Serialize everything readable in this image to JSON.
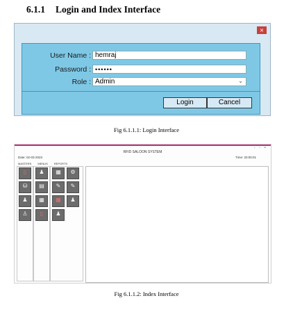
{
  "section": {
    "number": "6.1.1",
    "title": "Login and Index Interface"
  },
  "login": {
    "close_glyph": "×",
    "user_label": "User Name :",
    "user_value": "hemraj",
    "password_label": "Password :",
    "password_value": "••••••",
    "role_label": "Role :",
    "role_value": "Admin",
    "login_button": "Login",
    "cancel_button": "Cancel"
  },
  "caption1": "Fig 6.1.1.1: Login Interface",
  "index": {
    "window_controls": "- ▫ ×",
    "system_title": "RFID SALOON SYSTEM",
    "date": "Date:  02-03-2023",
    "time": "Time:  20:00:01",
    "menus": [
      "MASTERS",
      "MENUS",
      "REPORTS"
    ],
    "tiles": {
      "masters": [
        {
          "icon": "door-icon",
          "glyph": "▯",
          "label": ""
        },
        {
          "icon": "database-icon",
          "glyph": "⛁",
          "label": ""
        },
        {
          "icon": "people-icon",
          "glyph": "♟",
          "label": ""
        },
        {
          "icon": "person-icon",
          "glyph": "♙",
          "label": ""
        }
      ],
      "menus": [
        {
          "icon": "user-icon",
          "glyph": "♟",
          "label": ""
        },
        {
          "icon": "printer-icon",
          "glyph": "▤",
          "label": ""
        },
        {
          "icon": "chart-icon",
          "glyph": "▦",
          "label": ""
        },
        {
          "icon": "door-icon",
          "glyph": "▯",
          "label": ""
        }
      ],
      "reports_left": [
        {
          "icon": "register-icon",
          "glyph": "▦",
          "label": ""
        },
        {
          "icon": "pen-icon",
          "glyph": "✎",
          "label": ""
        },
        {
          "icon": "report-icon",
          "glyph": "▦",
          "label": ""
        },
        {
          "icon": "people-icon",
          "glyph": "♟",
          "label": ""
        }
      ],
      "reports_right": [
        {
          "icon": "network-icon",
          "glyph": "⚙",
          "label": ""
        },
        {
          "icon": "edit-icon",
          "glyph": "✎",
          "label": ""
        },
        {
          "icon": "people-icon",
          "glyph": "♟",
          "label": ""
        }
      ]
    }
  },
  "caption2": "Fig 6.1.1.2: Index Interface",
  "colors": {
    "login_panel": "#7ec8e6",
    "accent_line": "#c2307e",
    "tile": "#6c6c6c"
  }
}
